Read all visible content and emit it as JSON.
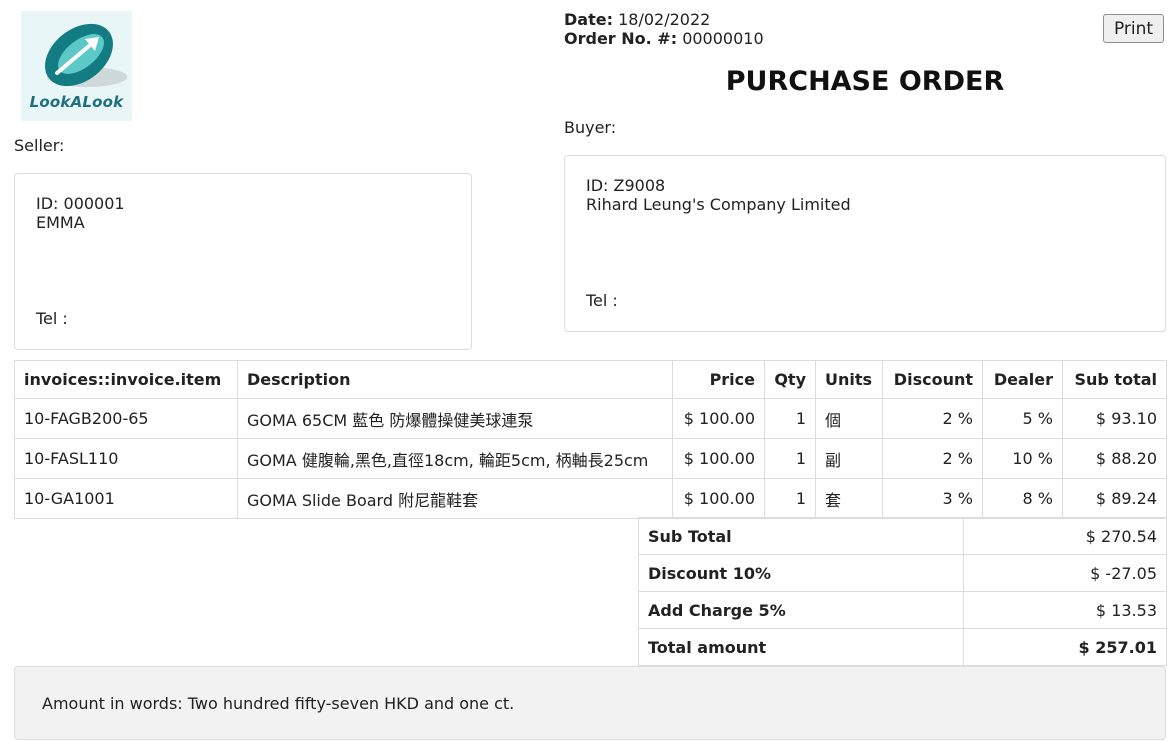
{
  "logo": {
    "text": "LookALook"
  },
  "header": {
    "date_label": "Date:",
    "date": "18/02/2022",
    "order_label": "Order No. #:",
    "order_no": "00000010",
    "print_label": "Print",
    "title": "PURCHASE ORDER"
  },
  "seller": {
    "label": "Seller:",
    "id": "ID: 000001",
    "name": "EMMA",
    "tel": "Tel :"
  },
  "buyer": {
    "label": "Buyer:",
    "id": "ID: Z9008",
    "name": "Rihard Leung's Company Limited",
    "tel": "Tel :"
  },
  "table": {
    "headers": [
      "invoices::invoice.item",
      "Description",
      "Price",
      "Qty",
      "Units",
      "Discount",
      "Dealer",
      "Sub total"
    ],
    "rows": [
      [
        "10-FAGB200-65",
        "GOMA 65CM 藍色 防爆體操健美球連泵",
        "$ 100.00",
        "1",
        "個",
        "2 %",
        "5 %",
        "$ 93.10"
      ],
      [
        "10-FASL110",
        "GOMA 健腹輪,黑色,直徑18cm, 輪距5cm, 柄軸長25cm",
        "$ 100.00",
        "1",
        "副",
        "2 %",
        "10 %",
        "$ 88.20"
      ],
      [
        "10-GA1001",
        "GOMA Slide Board 附尼龍鞋套",
        "$ 100.00",
        "1",
        "套",
        "3 %",
        "8 %",
        "$ 89.24"
      ]
    ]
  },
  "totals": [
    {
      "label": "Sub Total",
      "value": "$ 270.54"
    },
    {
      "label": "Discount 10%",
      "value": "$ -27.05"
    },
    {
      "label": "Add Charge 5%",
      "value": "$ 13.53"
    },
    {
      "label": "Total amount",
      "value": "$ 257.01"
    }
  ],
  "amount_in_words": "Amount in words: Two hundred fifty-seven HKD and one ct."
}
